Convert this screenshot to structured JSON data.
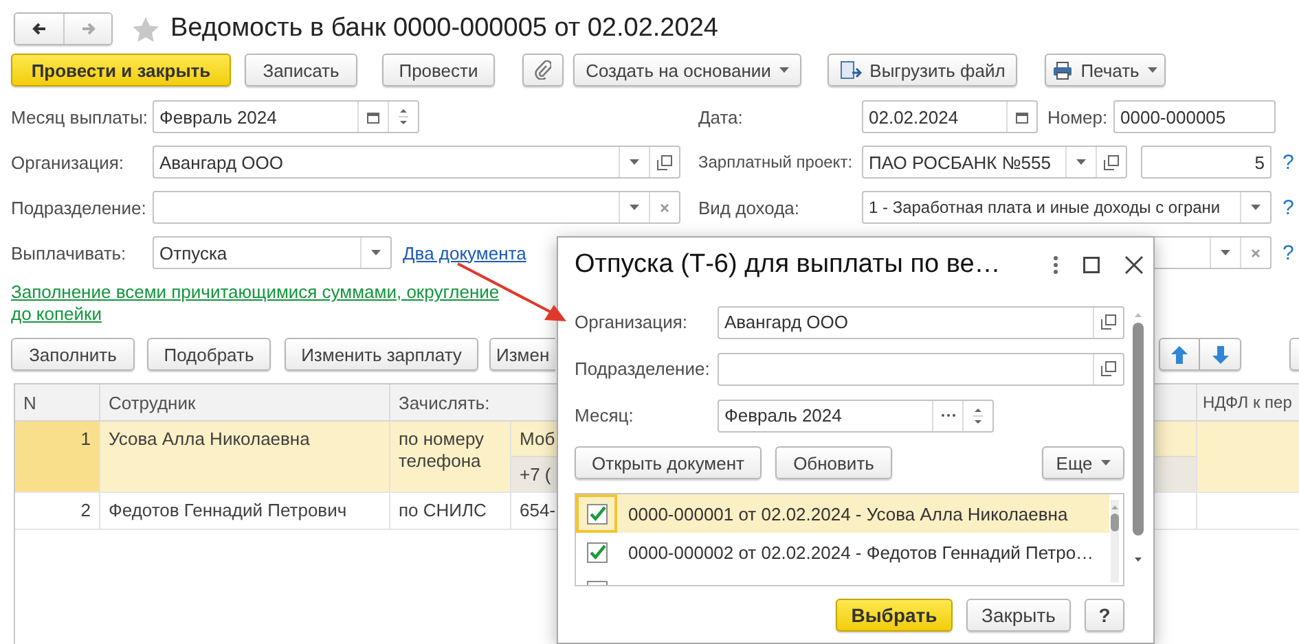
{
  "window": {
    "title": "Ведомость в банк 0000-000005 от 02.02.2024",
    "favorite": false
  },
  "navigation": {
    "back_enabled": true,
    "forward_enabled": false
  },
  "toolbar": [
    {
      "kind": "primary",
      "label": "Провести и закрыть"
    },
    {
      "kind": "button",
      "label": "Записать"
    },
    {
      "kind": "button",
      "label": "Провести"
    },
    {
      "kind": "attach"
    },
    {
      "kind": "menu",
      "label": "Создать на основании"
    },
    {
      "kind": "upload",
      "label": "Выгрузить файл"
    },
    {
      "kind": "print",
      "label": "Печать"
    }
  ],
  "form": {
    "pay_month": {
      "label": "Месяц выплаты:",
      "value": "Февраль 2024"
    },
    "date": {
      "label": "Дата:",
      "value": "02.02.2024"
    },
    "number": {
      "label": "Номер:",
      "value": "0000-000005"
    },
    "organization": {
      "label": "Организация:",
      "value": "Авангард ООО"
    },
    "salary_project": {
      "label": "Зарплатный проект:",
      "value": "ПАО РОСБАНК №555"
    },
    "card_count": {
      "value": "5",
      "help": "?"
    },
    "department": {
      "label": "Подразделение:"
    },
    "income_type": {
      "label": "Вид дохода:",
      "value": "1 - Заработная плата и иные доходы с ограни",
      "help": "?"
    },
    "pay_by": {
      "label": "Выплачивать:",
      "value": "Отпуска",
      "link": "Два документа"
    },
    "covered_field": {
      "help": "?"
    }
  },
  "fill_mode_link": "Заполнение всеми причитающимися суммами, округление до копейки",
  "table_toolbar": [
    {
      "kind": "button",
      "label": "Заполнить"
    },
    {
      "kind": "button",
      "label": "Подобрать"
    },
    {
      "kind": "button",
      "label": "Изменить зарплату"
    },
    {
      "kind": "button",
      "label": "Измен"
    },
    {
      "kind": "move-up"
    },
    {
      "kind": "move-down"
    },
    {
      "kind": "edge"
    }
  ],
  "table": {
    "columns": [
      {
        "label": "N"
      },
      {
        "label": "Сотрудник"
      },
      {
        "label": "Зачислять:"
      },
      {
        "label": "НДФЛ к пер"
      }
    ],
    "rows": [
      {
        "n": "1",
        "employee": "Усова Алла Николаевна",
        "credit_by": "по номеру телефона",
        "details": [
          "Моб",
          "+7 ("
        ],
        "selected": true
      },
      {
        "n": "2",
        "employee": "Федотов Геннадий Петрович",
        "credit_by": "по СНИЛС",
        "details": [
          "654-"
        ],
        "selected": false
      }
    ]
  },
  "dialog": {
    "title": "Отпуска (Т-6) для выплаты по ве…",
    "fields": [
      {
        "kind": "reference",
        "label": "Организация:",
        "value": "Авангард ООО"
      },
      {
        "kind": "reference",
        "label": "Подразделение:"
      },
      {
        "kind": "period",
        "label": "Месяц:",
        "value": "Февраль 2024"
      }
    ],
    "buttons": [
      "Открыть документ",
      "Обновить"
    ],
    "more": "Еще",
    "items": [
      {
        "text": "0000-000001 от 02.02.2024 - Усова Алла Николаевна",
        "checked": true,
        "selected": true
      },
      {
        "text": "0000-000002 от 02.02.2024 - Федотов Геннадий Петро…",
        "checked": true,
        "selected": false
      },
      {
        "checked": false,
        "selected": false
      }
    ],
    "footer": [
      {
        "kind": "primary",
        "label": "Выбрать"
      },
      {
        "kind": "button",
        "label": "Закрыть"
      },
      {
        "kind": "help",
        "label": "?"
      }
    ]
  }
}
